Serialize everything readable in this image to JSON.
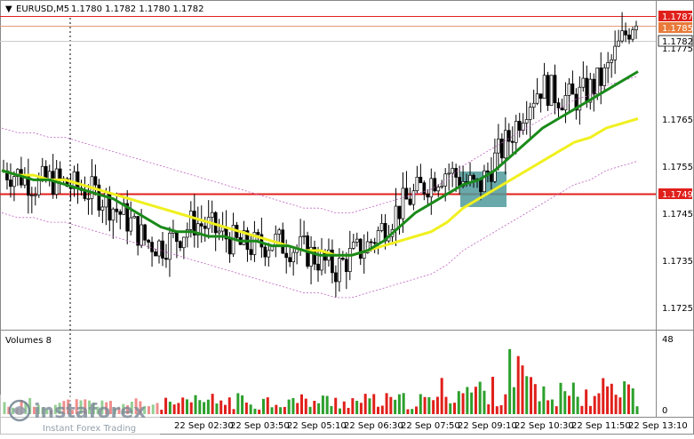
{
  "header": {
    "symbol_label": "EURUSD,M5",
    "ohlc_label": "1.1780 1.1782 1.1780 1.1782"
  },
  "price_axis": {
    "ticks": [
      "1.1775",
      "1.1765",
      "1.1755",
      "1.1745",
      "1.1735",
      "1.1725"
    ]
  },
  "price_badges": {
    "top_red": "1.1787",
    "orange": "1.1785",
    "current": "1.1782",
    "level": "1.1749"
  },
  "volume_panel": {
    "label": "Volumes 8",
    "ticks": [
      "48",
      "0"
    ]
  },
  "time_axis": {
    "labels": [
      "22 Sep 02:30",
      "22 Sep 03:50",
      "22 Sep 05:10",
      "22 Sep 06:30",
      "22 Sep 07:50",
      "22 Sep 09:10",
      "22 Sep 10:30",
      "22 Sep 11:50",
      "22 Sep 13:10"
    ]
  },
  "watermark": {
    "brand": "instaforex",
    "tagline": "Instant Forex Trading"
  },
  "colors": {
    "bull_volume": "#2ca02c",
    "bear_volume": "#e0201b",
    "ma_fast": "#1a8a1a",
    "ma_slow": "#f0f020",
    "level_line": "#e0201b",
    "highlight_box": "#4f9a9a"
  },
  "chart_data": {
    "type": "candlestick",
    "price_range": [
      1.172,
      1.1789
    ],
    "horizontal_levels": [
      1.1787,
      1.1785,
      1.1749
    ],
    "close_path": [
      1.1749,
      1.1748,
      1.1746,
      1.1747,
      1.1746,
      1.1745,
      1.1744,
      1.1741,
      1.1738,
      1.1734,
      1.1733,
      1.1735,
      1.1738,
      1.1737,
      1.1735,
      1.1733,
      1.1733,
      1.1734,
      1.1733,
      1.1732,
      1.173,
      1.1728,
      1.1731,
      1.1733,
      1.1737,
      1.1741,
      1.1744,
      1.1747,
      1.1749,
      1.1747,
      1.1745,
      1.1751,
      1.1756,
      1.1763,
      1.1767,
      1.1765,
      1.1764,
      1.1766,
      1.1769,
      1.1776,
      1.1782
    ],
    "ma_fast": [
      1.1749,
      1.1748,
      1.1747,
      1.1747,
      1.1746,
      1.1745,
      1.1744,
      1.1743,
      1.1741,
      1.1739,
      1.1737,
      1.1736,
      1.1736,
      1.1735,
      1.1735,
      1.1734,
      1.1734,
      1.1733,
      1.1733,
      1.1732,
      1.1731,
      1.1731,
      1.1731,
      1.1732,
      1.1734,
      1.1737,
      1.174,
      1.1742,
      1.1744,
      1.1746,
      1.1747,
      1.1749,
      1.1752,
      1.1755,
      1.1758,
      1.176,
      1.1762,
      1.1764,
      1.1766,
      1.1768,
      1.177
    ],
    "ma_slow": [
      1.1749,
      1.1748,
      1.1748,
      1.1747,
      1.1747,
      1.1746,
      1.1745,
      1.1744,
      1.1743,
      1.1742,
      1.1741,
      1.174,
      1.1739,
      1.1738,
      1.1737,
      1.1736,
      1.1735,
      1.1734,
      1.1733,
      1.1732,
      1.1732,
      1.1731,
      1.1731,
      1.1732,
      1.1733,
      1.1734,
      1.1735,
      1.1736,
      1.1738,
      1.1741,
      1.1743,
      1.1745,
      1.1747,
      1.1749,
      1.1751,
      1.1753,
      1.1755,
      1.1756,
      1.1758,
      1.1759,
      1.176
    ],
    "volume_ylim": [
      0,
      48
    ]
  }
}
